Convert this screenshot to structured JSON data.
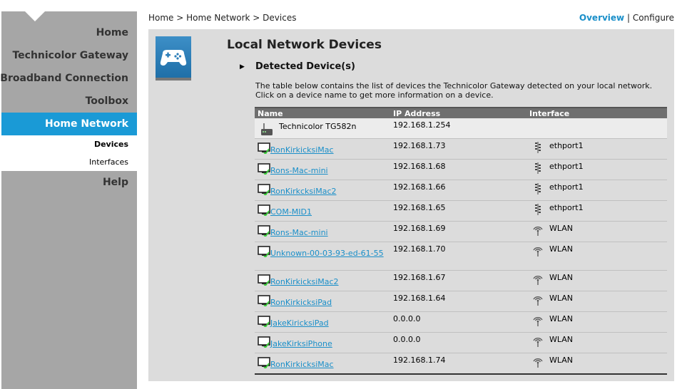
{
  "sidebar": {
    "items": [
      {
        "label": "Home"
      },
      {
        "label": "Technicolor Gateway"
      },
      {
        "label": "Broadband Connection"
      },
      {
        "label": "Toolbox"
      },
      {
        "label": "Home Network"
      },
      {
        "label": "Help"
      }
    ],
    "subitems": [
      {
        "label": "Devices"
      },
      {
        "label": "Interfaces"
      }
    ]
  },
  "breadcrumb": {
    "home": "Home",
    "sep1": " > ",
    "network": "Home Network",
    "sep2": " > ",
    "devices": "Devices"
  },
  "topnav": {
    "overview": "Overview",
    "sep": " | ",
    "configure": "Configure"
  },
  "page": {
    "title": "Local Network Devices",
    "section": "Detected Device(s)",
    "description": "The table below contains the list of devices the Technicolor Gateway detected on your local network. Click on a device name to get more information on a device."
  },
  "table": {
    "headers": {
      "name": "Name",
      "ip": "IP Address",
      "iface": "Interface"
    },
    "rows": [
      {
        "name": "Technicolor TG582n",
        "ip": "192.168.1.254",
        "iface": "",
        "type": "gateway"
      },
      {
        "name": "RonKirkicksiMac",
        "ip": "192.168.1.73",
        "iface": "ethport1",
        "type": "eth"
      },
      {
        "name": "Rons-Mac-mini",
        "ip": "192.168.1.68",
        "iface": "ethport1",
        "type": "eth"
      },
      {
        "name": "RonKirkcksiMac2",
        "ip": "192.168.1.66",
        "iface": "ethport1",
        "type": "eth"
      },
      {
        "name": "COM-MID1",
        "ip": "192.168.1.65",
        "iface": "ethport1",
        "type": "eth"
      },
      {
        "name": "Rons-Mac-mini",
        "ip": "192.168.1.69",
        "iface": "WLAN",
        "type": "wlan"
      },
      {
        "name": "Unknown-00-03-93-ed-61-55",
        "ip": "192.168.1.70",
        "iface": "WLAN",
        "type": "wlan"
      },
      {
        "name": "RonKirkicksiMac2",
        "ip": "192.168.1.67",
        "iface": "WLAN",
        "type": "wlan"
      },
      {
        "name": "RonKirkicksiPad",
        "ip": "192.168.1.64",
        "iface": "WLAN",
        "type": "wlan"
      },
      {
        "name": "JakeKiricksiPad",
        "ip": "0.0.0.0",
        "iface": "WLAN",
        "type": "wlan"
      },
      {
        "name": "JakeKirksiPhone",
        "ip": "0.0.0.0",
        "iface": "WLAN",
        "type": "wlan"
      },
      {
        "name": "RonKirkicksiMac",
        "ip": "192.168.1.74",
        "iface": "WLAN",
        "type": "wlan"
      }
    ]
  },
  "colors": {
    "accent": "#1a9ad6",
    "sidebar": "#a6a6a6",
    "panel": "#dcdcdc",
    "link": "#1a8fc9"
  }
}
